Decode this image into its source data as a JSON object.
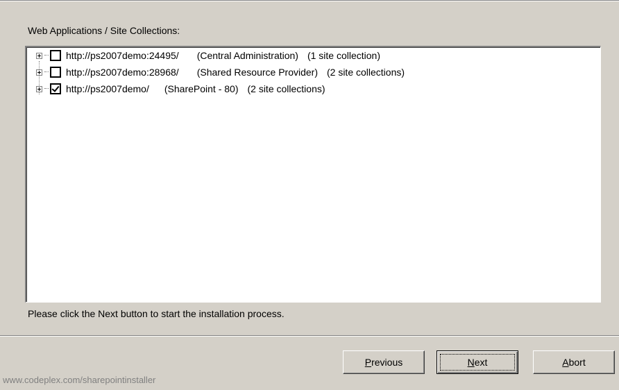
{
  "group_label": "Web Applications / Site Collections:",
  "tree": {
    "items": [
      {
        "url": "http://ps2007demo:24495/",
        "name": "(Central Administration)",
        "count": "(1 site collection)",
        "checked": false
      },
      {
        "url": "http://ps2007demo:28968/",
        "name": "(Shared Resource Provider)",
        "count": "(2 site collections)",
        "checked": false
      },
      {
        "url": "http://ps2007demo/",
        "name": "(SharePoint - 80)",
        "count": "(2 site collections)",
        "checked": true
      }
    ]
  },
  "status_text": "Please click the Next button to start the installation process.",
  "buttons": {
    "previous": {
      "accel": "P",
      "rest": "revious"
    },
    "next": {
      "accel": "N",
      "rest": "ext"
    },
    "abort": {
      "accel": "A",
      "rest": "bort"
    }
  },
  "footer_text": "www.codeplex.com/sharepointinstaller"
}
